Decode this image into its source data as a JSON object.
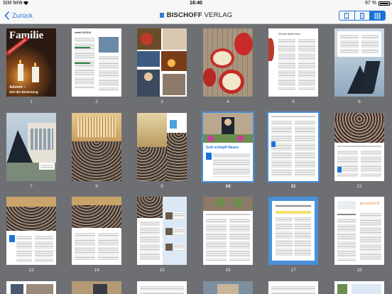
{
  "status_bar": {
    "carrier": "SIM fehlt",
    "time": "16:40",
    "battery_text": "97 %",
    "battery_level": 0.97
  },
  "nav": {
    "back_label": "Zurück",
    "title_bold": "BISCHOFF",
    "title_rest": " VERLAG",
    "view_modes": [
      {
        "name": "single-page-view",
        "active": false
      },
      {
        "name": "double-page-view",
        "active": false
      },
      {
        "name": "grid-view",
        "active": true
      }
    ]
  },
  "pages": [
    {
      "number": "1",
      "cover": {
        "title": "Familie",
        "stripe": "ADVENTSAUSGABE",
        "headline": "Advent –",
        "subline": "Zeit der Besinnung"
      }
    },
    {
      "number": "2",
      "heading": "Inhalt 23/2016"
    },
    {
      "number": "3"
    },
    {
      "number": "4"
    },
    {
      "number": "5",
      "heading": "Mit dem Apfel leben"
    },
    {
      "number": "6"
    },
    {
      "number": "7"
    },
    {
      "number": "8"
    },
    {
      "number": "9"
    },
    {
      "number": "10",
      "headline": "Gott schöpft Neues"
    },
    {
      "number": "11"
    },
    {
      "number": "12"
    },
    {
      "number": "13"
    },
    {
      "number": "14"
    },
    {
      "number": "15"
    },
    {
      "number": "16"
    },
    {
      "number": "17"
    },
    {
      "number": "18",
      "headline": "persönlich"
    },
    {
      "number": ""
    },
    {
      "number": ""
    },
    {
      "number": ""
    },
    {
      "number": ""
    },
    {
      "number": ""
    },
    {
      "number": ""
    }
  ]
}
